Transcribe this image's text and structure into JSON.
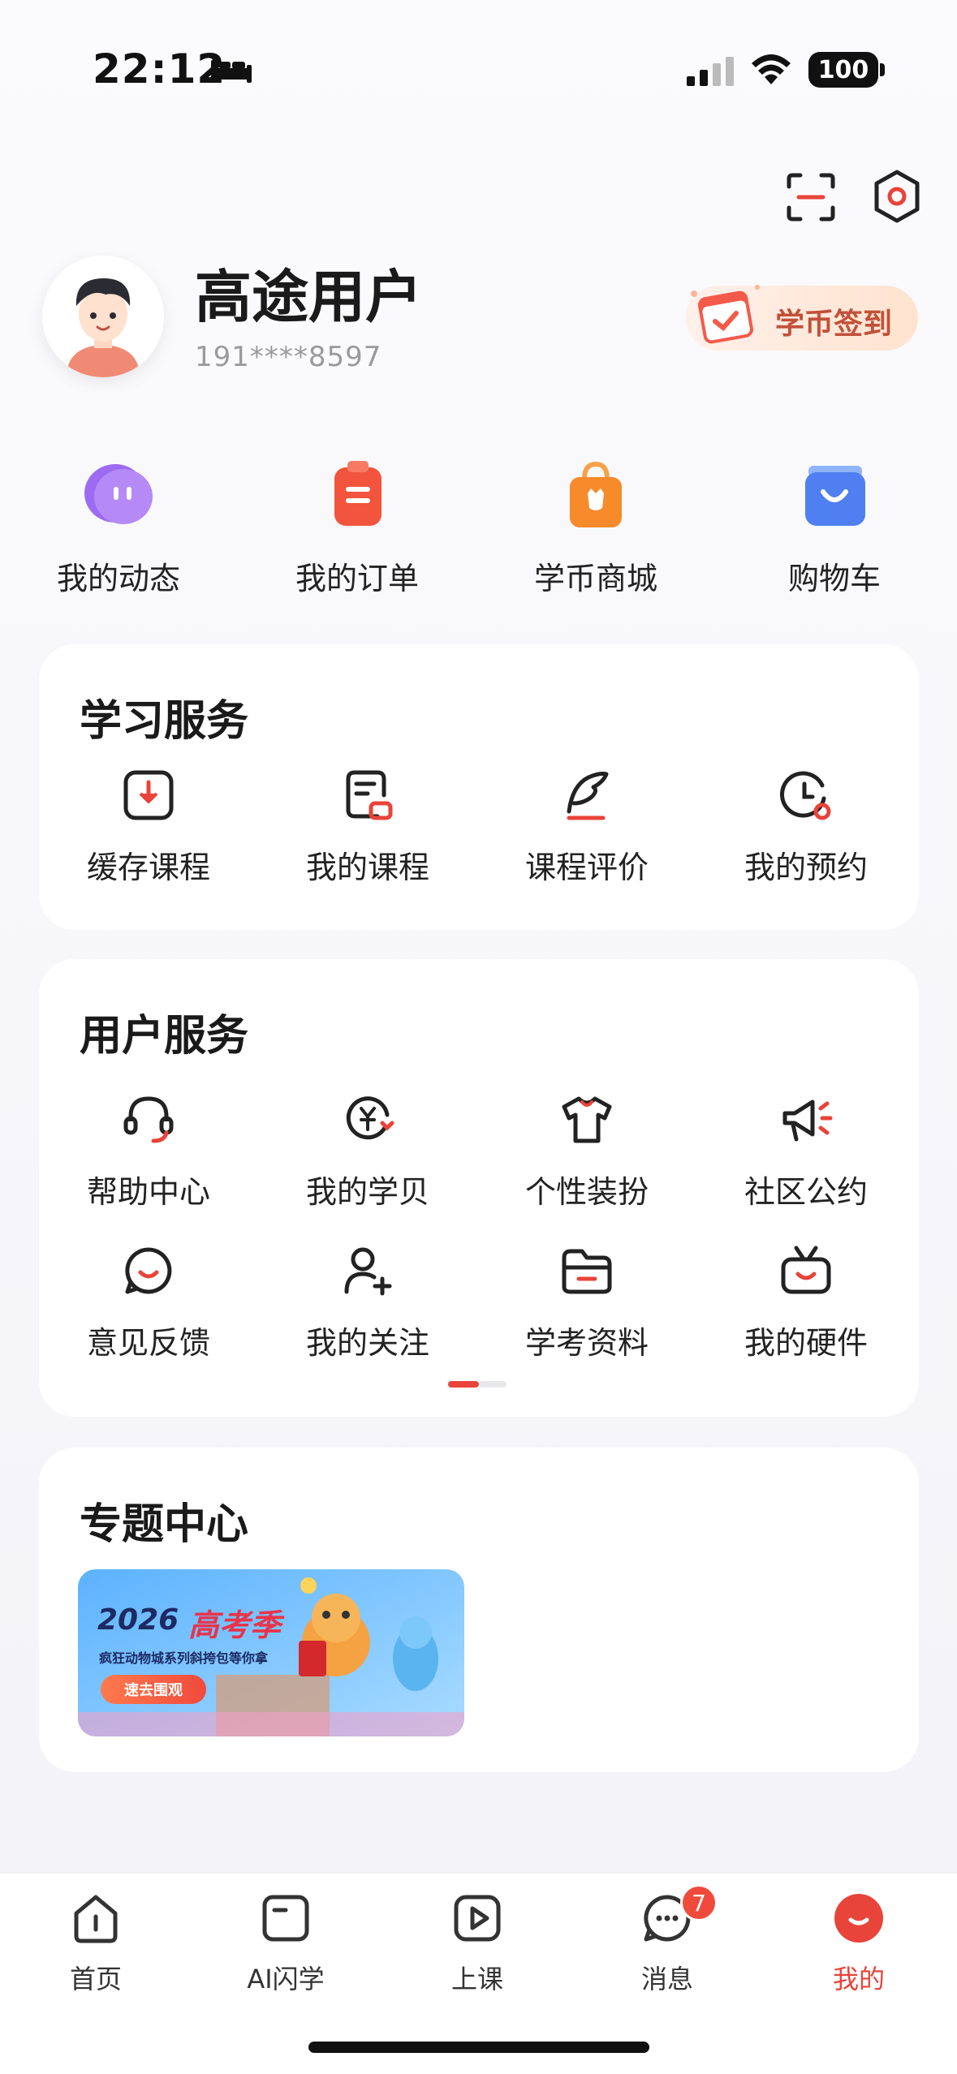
{
  "status_bar": {
    "time": "22:12",
    "battery": "100"
  },
  "profile": {
    "name": "高途用户",
    "phone": "191****8597",
    "checkin_label": "学币签到"
  },
  "quick_actions": [
    {
      "label": "我的动态",
      "icon": "chat-bubble-icon"
    },
    {
      "label": "我的订单",
      "icon": "order-clipboard-icon"
    },
    {
      "label": "学币商城",
      "icon": "shopping-bag-icon"
    },
    {
      "label": "购物车",
      "icon": "cart-box-icon"
    }
  ],
  "study_services": {
    "title": "学习服务",
    "items": [
      {
        "label": "缓存课程",
        "icon": "download-icon"
      },
      {
        "label": "我的课程",
        "icon": "course-doc-icon"
      },
      {
        "label": "课程评价",
        "icon": "quill-icon"
      },
      {
        "label": "我的预约",
        "icon": "clock-icon"
      }
    ]
  },
  "user_services": {
    "title": "用户服务",
    "items": [
      {
        "label": "帮助中心",
        "icon": "headset-icon"
      },
      {
        "label": "我的学贝",
        "icon": "yen-coin-icon"
      },
      {
        "label": "个性装扮",
        "icon": "tshirt-icon"
      },
      {
        "label": "社区公约",
        "icon": "megaphone-icon"
      },
      {
        "label": "意见反馈",
        "icon": "feedback-bubble-icon"
      },
      {
        "label": "我的关注",
        "icon": "user-plus-icon"
      },
      {
        "label": "学考资料",
        "icon": "folder-icon"
      },
      {
        "label": "我的硬件",
        "icon": "tv-device-icon"
      }
    ]
  },
  "topic_center": {
    "title": "专题中心",
    "banner": {
      "year": "2026",
      "headline": "高考季",
      "subline": "疯狂动物城系列斜挎包等你拿",
      "button": "速去围观"
    }
  },
  "tab_bar": {
    "tabs": [
      {
        "label": "首页",
        "icon": "home-icon"
      },
      {
        "label": "AI闪学",
        "icon": "book-icon"
      },
      {
        "label": "上课",
        "icon": "play-icon"
      },
      {
        "label": "消息",
        "icon": "message-icon",
        "badge": "7"
      },
      {
        "label": "我的",
        "icon": "profile-face-icon",
        "active": true
      }
    ]
  },
  "colors": {
    "accent": "#e8443a",
    "text": "#222222",
    "muted": "#9a9a9a"
  }
}
